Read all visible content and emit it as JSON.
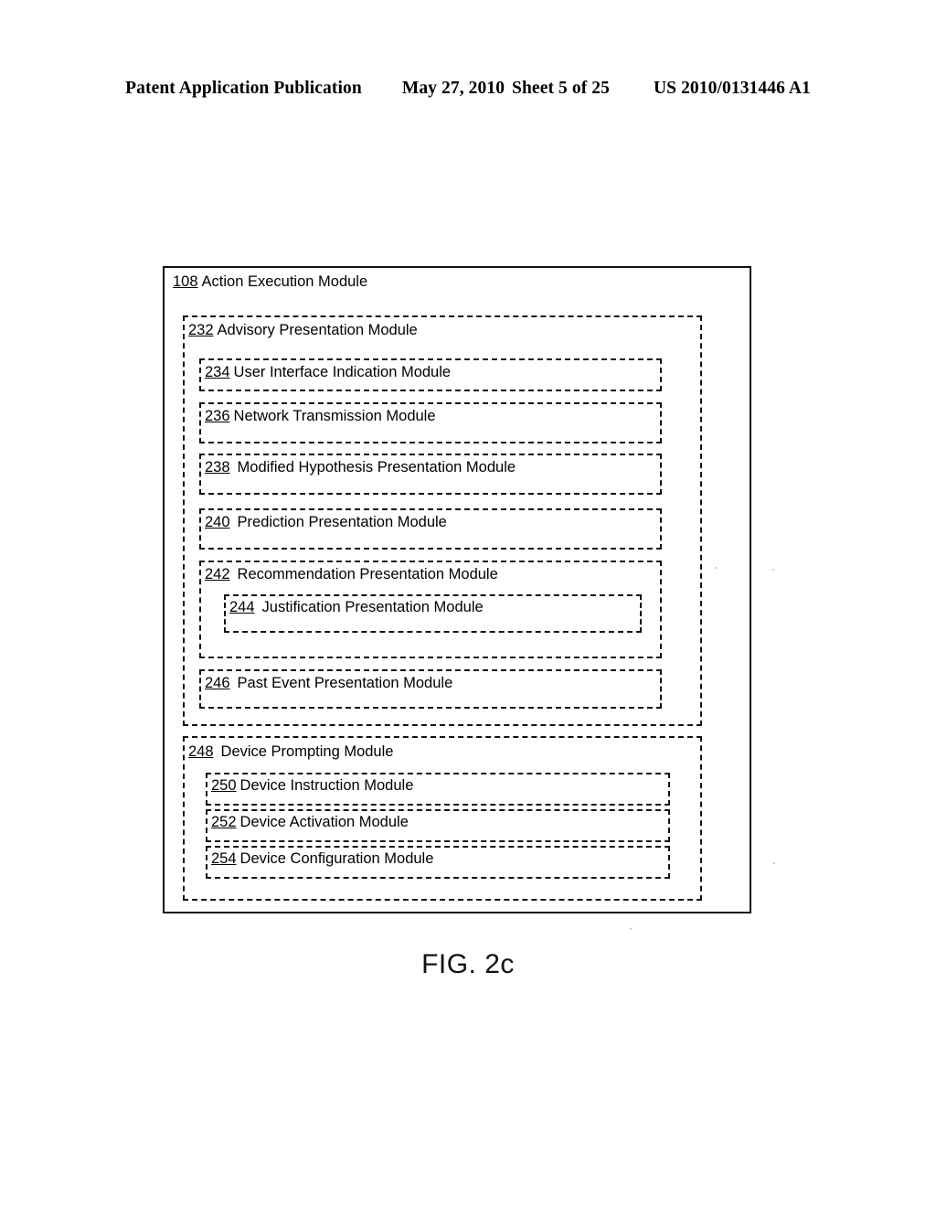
{
  "header": {
    "publication": "Patent Application Publication",
    "date": "May 27, 2010",
    "sheet": "Sheet 5 of 25",
    "patent_number": "US 2010/0131446 A1"
  },
  "figure": {
    "caption": "FIG. 2c",
    "root": {
      "number": "108",
      "title": "Action Execution Module"
    },
    "modules": [
      {
        "number": "232",
        "title": "Advisory Presentation Module"
      },
      {
        "number": "234",
        "title": "User Interface Indication Module"
      },
      {
        "number": "236",
        "title": "Network Transmission Module"
      },
      {
        "number": "238",
        "title": "Modified Hypothesis Presentation Module"
      },
      {
        "number": "240",
        "title": "Prediction Presentation Module"
      },
      {
        "number": "242",
        "title": "Recommendation Presentation Module"
      },
      {
        "number": "244",
        "title": "Justification Presentation Module"
      },
      {
        "number": "246",
        "title": "Past Event Presentation Module"
      },
      {
        "number": "248",
        "title": "Device Prompting Module"
      },
      {
        "number": "250",
        "title": "Device Instruction Module"
      },
      {
        "number": "252",
        "title": "Device Activation Module"
      },
      {
        "number": "254",
        "title": "Device Configuration Module"
      }
    ]
  }
}
